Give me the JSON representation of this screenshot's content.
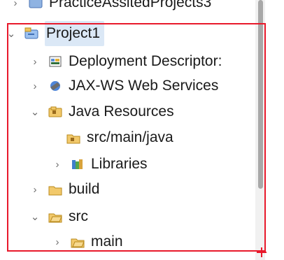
{
  "tree": {
    "top_item": "PracticeAssitedProjects3",
    "project": "Project1",
    "items": {
      "deployment": "Deployment Descriptor:",
      "jaxws": "JAX-WS Web Services",
      "java_resources": "Java Resources",
      "src_main_java": "src/main/java",
      "libraries": "Libraries",
      "build": "build",
      "src": "src",
      "main": "main"
    }
  },
  "colors": {
    "highlight": "#e8192b",
    "selection": "#dbe8f6",
    "folder": "#e9b949"
  }
}
